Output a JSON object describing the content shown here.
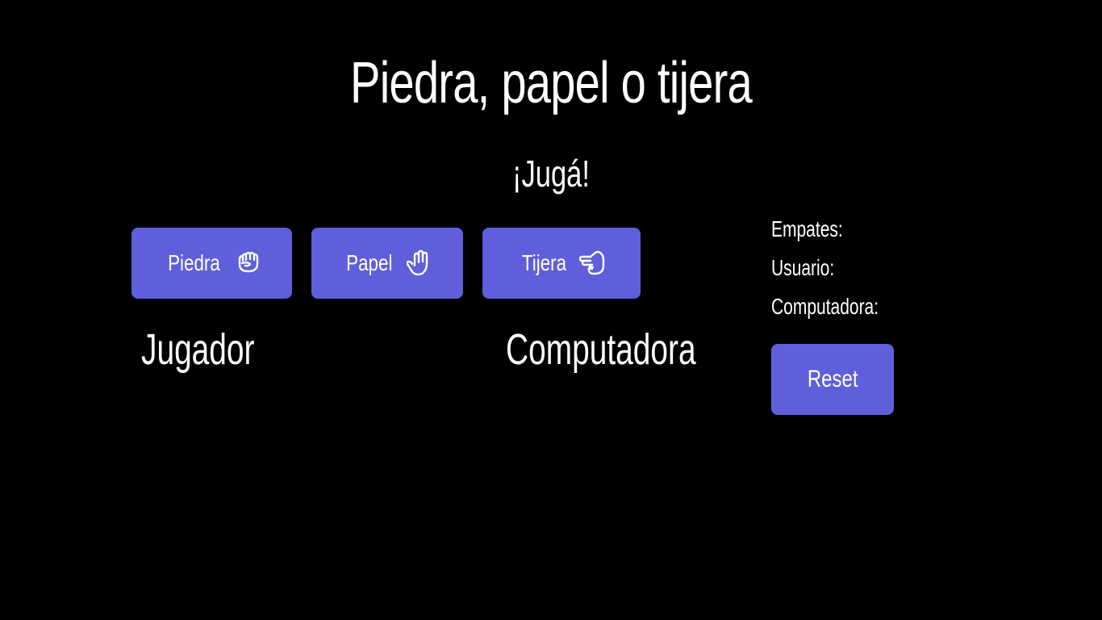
{
  "header": {
    "title": "Piedra, papel o tijera",
    "subtitle": "¡Jugá!"
  },
  "choices": [
    {
      "label": "Piedra",
      "icon": "fist-icon"
    },
    {
      "label": "Papel",
      "icon": "open-hand-icon"
    },
    {
      "label": "Tijera",
      "icon": "scissors-hand-icon"
    }
  ],
  "board": {
    "player_label": "Jugador",
    "computer_label": "Computadora"
  },
  "scoreboard": {
    "ties_label": "Empates:",
    "user_label": "Usuario:",
    "computer_label": "Computadora:"
  },
  "reset_label": "Reset",
  "colors": {
    "background": "#000000",
    "button": "#5f5fdb",
    "text": "#ffffff"
  }
}
